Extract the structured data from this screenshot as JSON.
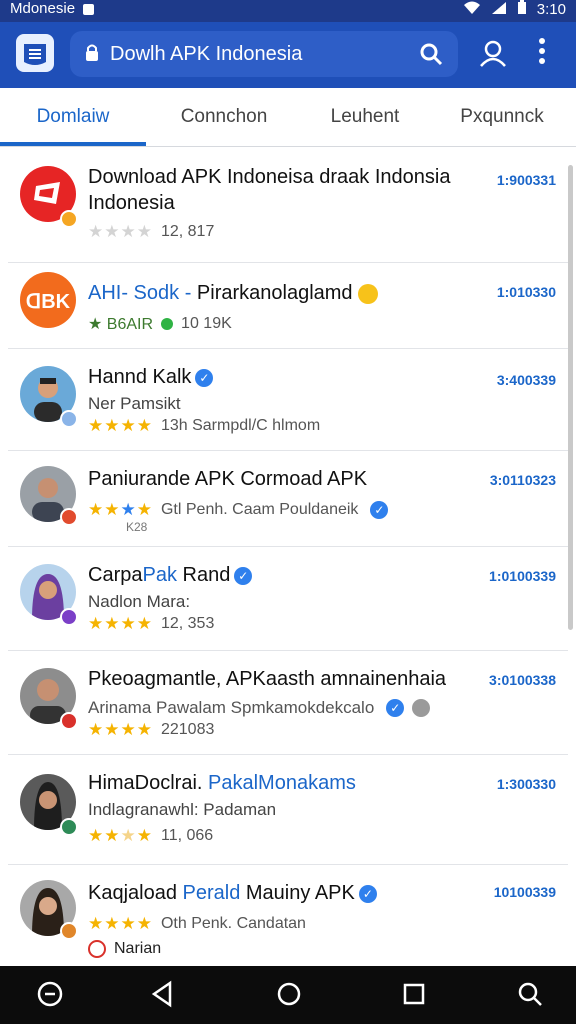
{
  "status_bar": {
    "carrier": "Mdonesie",
    "time": "3:10"
  },
  "app_bar": {
    "search_text": "Dowlh APK Indonesia"
  },
  "tabs": [
    "Domlaiw",
    "Connchon",
    "Leuhent",
    "Pxqunnck"
  ],
  "apps": [
    {
      "title": "Download APK Indoneisa draak Indonsia",
      "title_line2": "Indonesia",
      "rating": "12, 817",
      "size": "1:900331"
    },
    {
      "title_hl": "AHI- Sodk -",
      "title_rest": " Pirarkanolaglamd",
      "publisher": "B6AIR",
      "rating": "10 19K",
      "size": "1:010330"
    },
    {
      "title": "Hannd Kalk",
      "sub": "Ner Pamsikt",
      "rating": "13h Sarmpdl/C hlmom",
      "size": "3:400339"
    },
    {
      "title": "Paniurande APK Cormoad APK",
      "sub": "Gtl Penh. Caam Pouldaneik",
      "extra": "K28",
      "size": "3:0110323"
    },
    {
      "title_a": "Carpa",
      "title_hl": "Pak",
      "title_b": " Rand",
      "sub": "Nadlon Mara:",
      "rating": "12, 353",
      "size": "1:0100339"
    },
    {
      "title": "Pkeoagmantle, APKaasth amnainenhaia",
      "sub": "Arinama Pawalam Spmkamokdekcalo",
      "rating": "221083",
      "size": "3:0100338"
    },
    {
      "title_a": "HimaDoclrai. ",
      "title_hl": "PakalMonakams",
      "sub": "Indlagranawhl: Padaman",
      "rating": "11, 066",
      "size": "1:300330"
    },
    {
      "title_a": "Kaqjaload ",
      "title_hl": "Perald",
      "title_b": " Mauiny APK",
      "sub": "Oth Penk. Candatan",
      "footer": "Narian",
      "size": "10100339"
    }
  ]
}
